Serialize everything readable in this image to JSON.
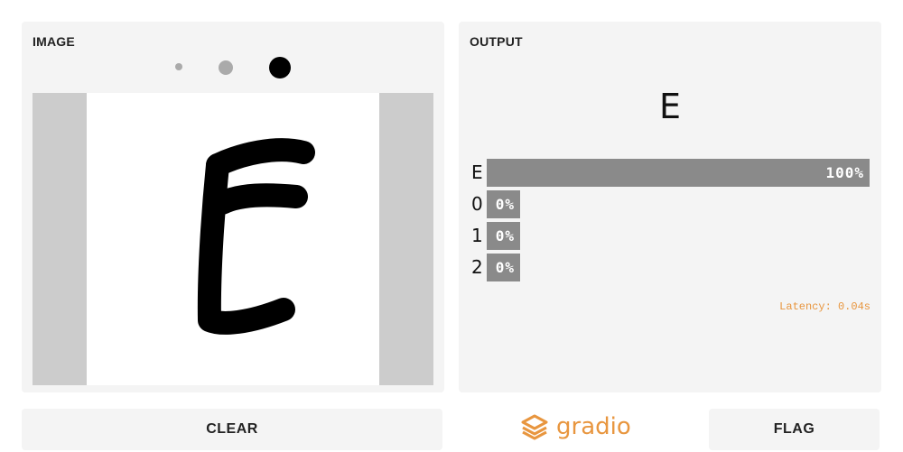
{
  "input": {
    "title": "IMAGE",
    "brush_sizes": [
      "small",
      "medium",
      "large"
    ]
  },
  "output": {
    "title": "OUTPUT",
    "predicted": "E",
    "confidences": [
      {
        "label": "E",
        "value": 1.0,
        "text": "100%"
      },
      {
        "label": "0",
        "value": 0.0,
        "text": "0%"
      },
      {
        "label": "1",
        "value": 0.0,
        "text": "0%"
      },
      {
        "label": "2",
        "value": 0.0,
        "text": "0%"
      }
    ],
    "latency": "Latency: 0.04s"
  },
  "buttons": {
    "clear": "CLEAR",
    "flag": "FLAG"
  },
  "branding": {
    "name": "gradio",
    "color": "#e8963f"
  }
}
